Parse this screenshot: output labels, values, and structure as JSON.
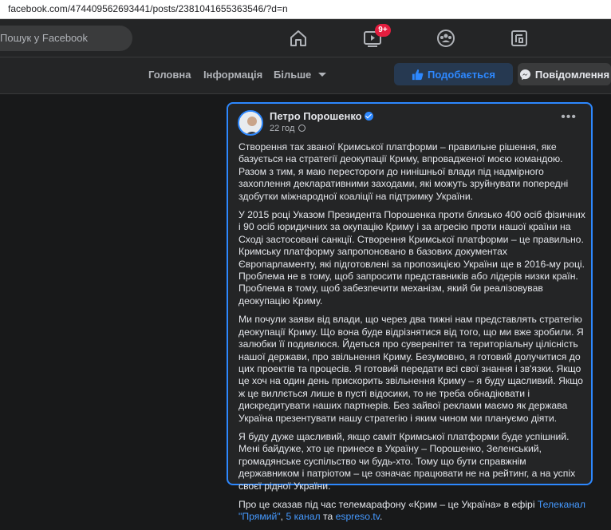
{
  "browser": {
    "url": "facebook.com/474409562693441/posts/2381041655363546/?d=n"
  },
  "header": {
    "search_placeholder": "Пошук у Facebook",
    "notification_badge": "9+",
    "icons": [
      "home-icon",
      "watch-icon",
      "groups-icon",
      "gaming-icon"
    ]
  },
  "page_nav": {
    "tabs": [
      "Головна",
      "Інформація",
      "Більше"
    ],
    "like_button": "Подобається",
    "message_button": "Повідомлення"
  },
  "post": {
    "author": "Петро Порошенко",
    "time": "22 год",
    "paragraphs": [
      "Створення так званої Кримської платформи – правильне рішення, яке базується на стратегії деокупації Криму, впровадженої моєю командою. Разом з тим, я маю перестороги до нинішньої влади під надмірного захоплення декларативними заходами, які можуть зруйнувати попередні здобутки міжнародної коаліції на підтримку України.",
      "У 2015 році Указом Президента Порошенка проти близько 400 осіб фізичних і 90 осіб юридичних за окупацію Криму і за агресію проти нашої країни на Сході застосовані санкції. Створення Кримської платформи – це правильно. Кримську платформу запропоновано в базових документах Європарламенту, які підготовлені за пропозицією України ще в 2016-му році. Проблема не в тому, щоб запросити представників або лідерів низки країн. Проблема в тому, щоб забезпечити механізм, який би реалізовував деокупацію Криму.",
      "Ми почули заяви від влади, що через два тижні нам представлять стратегію деокупації Криму. Що вона буде відрізнятися від того, що ми вже зробили. Я залюбки її подивлюся. Йдеться про суверенітет та територіальну цілісність нашої держави, про звільнення Криму. Безумовно, я готовий долучитися до цих проектів та процесів. Я готовий передати всі свої знання і зв'язки. Якщо це хоч на один день прискорить звільнення Криму – я буду щасливий. Якщо ж це виллється лише в пусті відосики, то не треба обнадіювати і дискредитувати наших партнерів. Без зайвої реклами маємо як держава Україна презентувати нашу стратегію і яким чином ми плануємо діяти.",
      "Я буду дуже щасливий, якщо саміт Кримської платформи буде успішний. Мені байдуже, хто це принесе в Україну – Порошенко, Зеленський, громадянське суспільство чи будь-хто. Тому що бути справжнім державником і патріотом – це означає працювати не на рейтинг, а на успіх своєї рідної України."
    ],
    "last_paragraph": {
      "text": "Про це сказав під час телемарафону «Крим – це Україна» в ефірі ",
      "link1": "Телеканал \"Прямий\"",
      "sep1": ", ",
      "link2": "5 канал",
      "sep2": " та ",
      "link3": "espreso.tv",
      "end": "."
    }
  },
  "colors": {
    "accent": "#2d88ff",
    "background": "#18191a",
    "surface": "#242526",
    "text": "#e4e6eb",
    "muted": "#b0b3b8"
  }
}
